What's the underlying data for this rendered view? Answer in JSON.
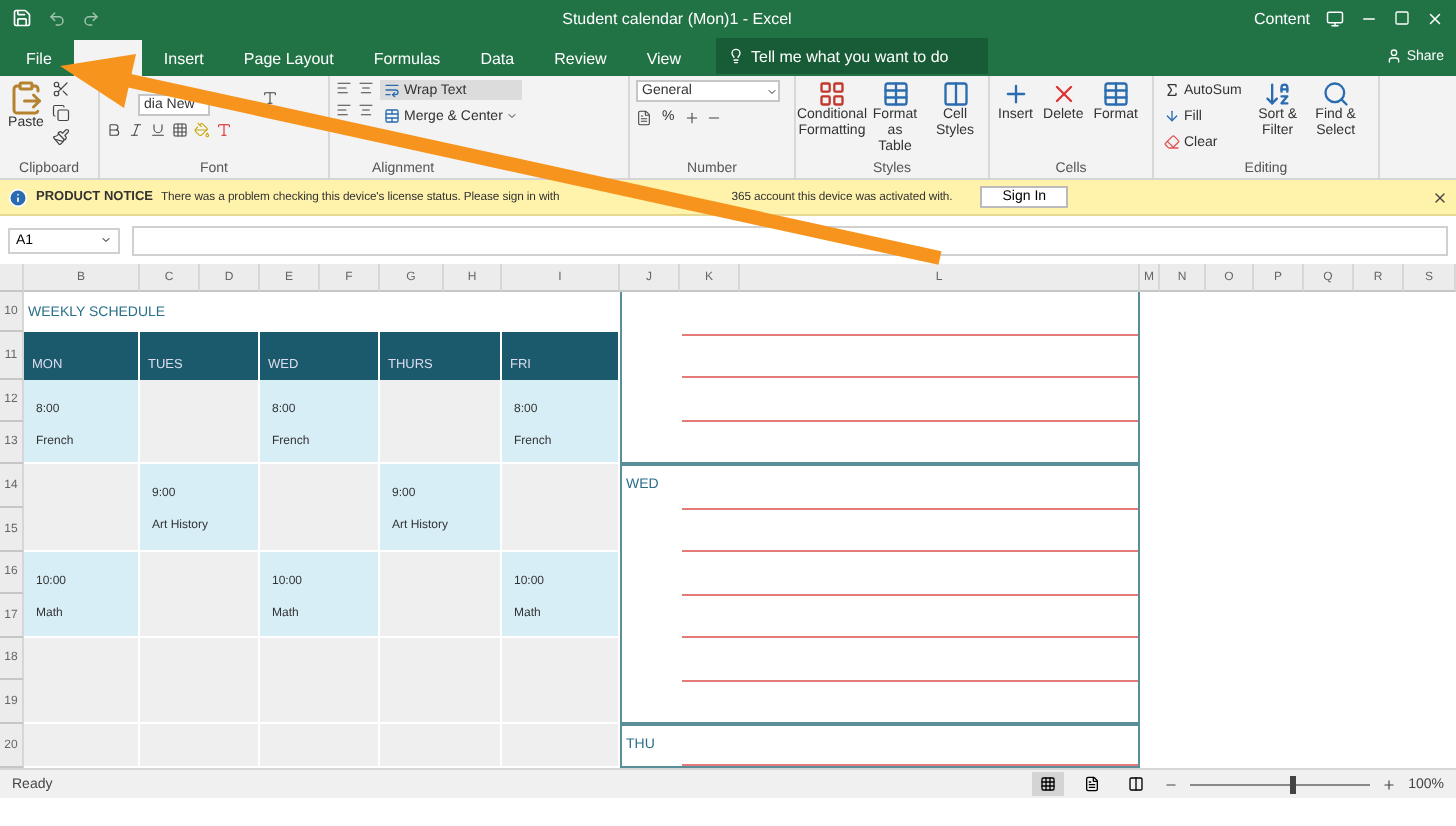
{
  "title_bar": {
    "title": "Student calendar (Mon)1  -  Excel",
    "account": "Content"
  },
  "tabs": [
    {
      "label": "File",
      "selected": false
    },
    {
      "selected": true
    },
    {
      "label": "Insert",
      "selected": false
    },
    {
      "label": "Page Layout",
      "selected": false
    },
    {
      "label": "Formulas",
      "selected": false
    },
    {
      "label": "Data",
      "selected": false
    },
    {
      "label": "Review",
      "selected": false
    },
    {
      "label": "View",
      "selected": false
    }
  ],
  "tell_me": {
    "placeholder": "Tell me what you want to do"
  },
  "share": "Share",
  "ribbon": {
    "clipboard": {
      "paste": "Paste",
      "label": "Clipboard"
    },
    "font": {
      "name": "dia New",
      "label": "Font"
    },
    "alignment": {
      "wrap": "Wrap Text",
      "merge": "Merge & Center",
      "label": "Alignment"
    },
    "number": {
      "format": "General",
      "percent": "%",
      "label": "Number"
    },
    "styles": {
      "buttons": [
        "Conditional Formatting",
        "Format as Table",
        "Cell Styles"
      ],
      "label": "Styles"
    },
    "cells": {
      "buttons": [
        "Insert",
        "Delete",
        "Format"
      ],
      "label": "Cells"
    },
    "editing": {
      "autosum": "AutoSum",
      "fill": "Fill",
      "clear": "Clear",
      "buttons": [
        "Sort & Filter",
        "Find & Select"
      ],
      "label": "Editing"
    }
  },
  "notice": {
    "title": "PRODUCT NOTICE",
    "message_parts": [
      "There was a problem checking this device's license status. Please sign in with",
      "365 account this device was activated with."
    ],
    "button": "Sign In"
  },
  "formula_bar": {
    "name_box": "A1"
  },
  "sheet": {
    "columns": [
      "B",
      "C",
      "D",
      "E",
      "F",
      "G",
      "H",
      "I",
      "J",
      "K",
      "L",
      "M",
      "N",
      "O",
      "P",
      "Q",
      "R",
      "S"
    ],
    "rows": [
      "10",
      "11",
      "12",
      "13",
      "14",
      "15",
      "16",
      "17",
      "18",
      "19",
      "20"
    ],
    "title": "WEEKLY SCHEDULE",
    "days": [
      "MON",
      "TUES",
      "WED",
      "THURS",
      "FRI"
    ],
    "slots": [
      [
        {
          "kind": "class",
          "time": "8:00",
          "subject": "French"
        },
        {
          "kind": "free"
        },
        {
          "kind": "class",
          "time": "8:00",
          "subject": "French"
        },
        {
          "kind": "free"
        },
        {
          "kind": "class",
          "time": "8:00",
          "subject": "French"
        }
      ],
      [
        {
          "kind": "free"
        },
        {
          "kind": "class",
          "time": "9:00",
          "subject": "Art History"
        },
        {
          "kind": "free"
        },
        {
          "kind": "class",
          "time": "9:00",
          "subject": "Art History"
        },
        {
          "kind": "free"
        }
      ],
      [
        {
          "kind": "class",
          "time": "10:00",
          "subject": "Math"
        },
        {
          "kind": "free"
        },
        {
          "kind": "class",
          "time": "10:00",
          "subject": "Math"
        },
        {
          "kind": "free"
        },
        {
          "kind": "class",
          "time": "10:00",
          "subject": "Math"
        }
      ],
      [
        {
          "kind": "free"
        },
        {
          "kind": "free"
        },
        {
          "kind": "free"
        },
        {
          "kind": "free"
        },
        {
          "kind": "free"
        }
      ],
      [
        {
          "kind": "free"
        },
        {
          "kind": "free"
        },
        {
          "kind": "free"
        },
        {
          "kind": "free"
        },
        {
          "kind": "free"
        }
      ]
    ],
    "notes": [
      {
        "kind": "blank"
      },
      {
        "kind": "day",
        "label": "WED"
      },
      {
        "kind": "day",
        "label": "THU"
      }
    ]
  },
  "status_bar": {
    "text": "Ready",
    "views": [
      {
        "selected": true
      },
      {
        "selected": false
      },
      {
        "selected": false
      }
    ],
    "zoom": {
      "level": 0.55,
      "reading": "100%"
    }
  }
}
